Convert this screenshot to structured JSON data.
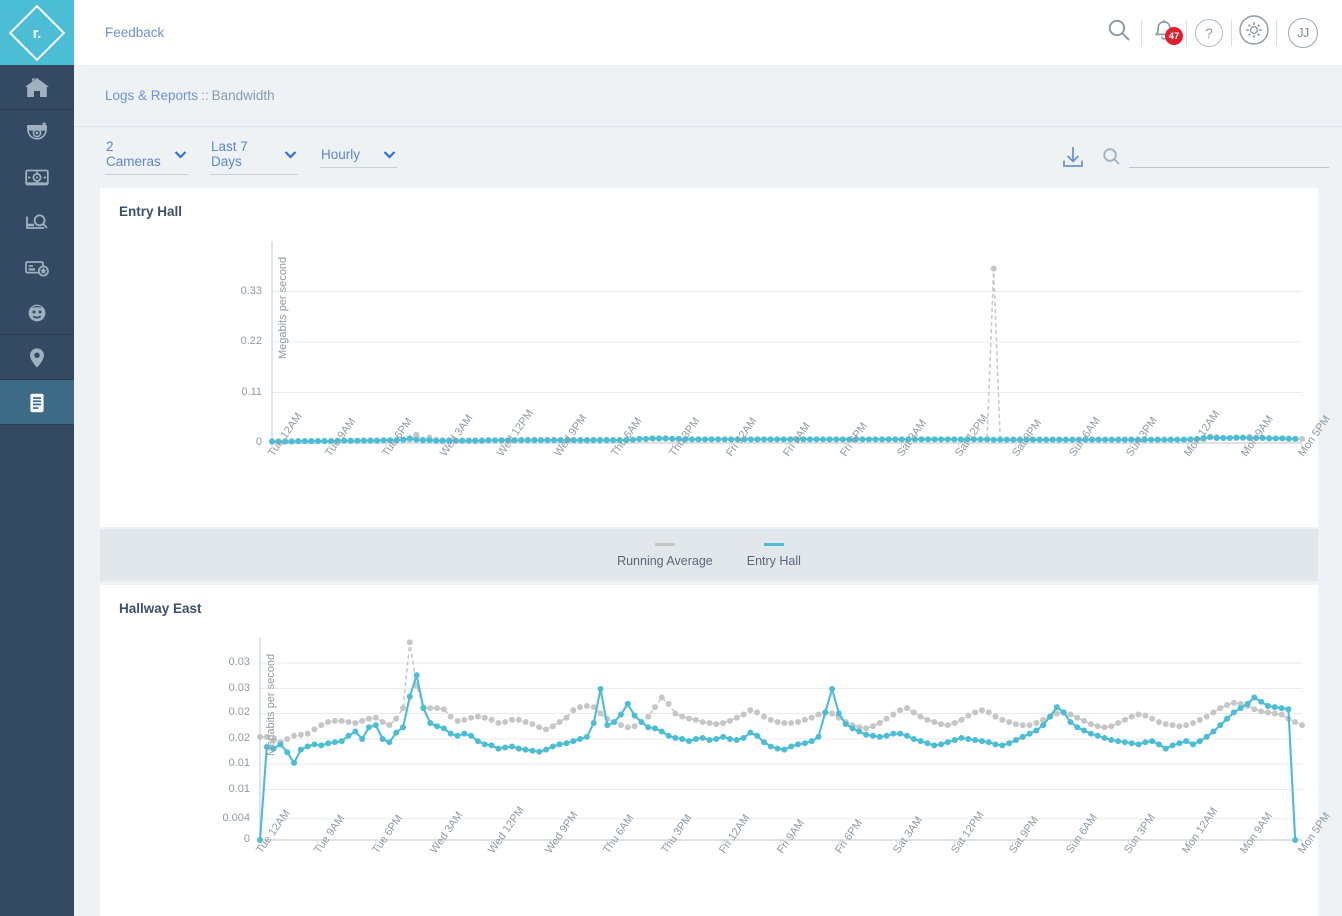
{
  "app": {
    "logo_text": "r.",
    "brand_color": "#4bbdd4",
    "sidebar_bg": "#344a63",
    "sidebar_active_bg": "#3d6a85"
  },
  "sidebar": {
    "items": [
      {
        "name": "sidebar-item-dashboard",
        "icon": "home-icon",
        "active": false,
        "divider": true
      },
      {
        "name": "sidebar-item-cameras",
        "icon": "dome-camera-icon",
        "active": false,
        "divider": false
      },
      {
        "name": "sidebar-item-monitor",
        "icon": "monitor-target-icon",
        "active": false,
        "divider": false
      },
      {
        "name": "sidebar-item-investigate",
        "icon": "search-footage-icon",
        "active": false,
        "divider": false
      },
      {
        "name": "sidebar-item-license-plate",
        "icon": "card-star-icon",
        "active": false,
        "divider": false
      },
      {
        "name": "sidebar-item-people",
        "icon": "face-icon",
        "active": false,
        "divider": true
      },
      {
        "name": "sidebar-item-locations",
        "icon": "map-pin-icon",
        "active": false,
        "divider": true
      },
      {
        "name": "sidebar-item-logs-reports",
        "icon": "document-lines-icon",
        "active": true,
        "divider": true
      }
    ]
  },
  "topbar": {
    "feedback_label": "Feedback",
    "search_icon": "search-icon",
    "notifications_icon": "bell-icon",
    "notifications_count": "47",
    "notifications_badge_color": "#e0212b",
    "help_icon": "question-mark-icon",
    "help_label": "?",
    "settings_icon": "gear-icon",
    "avatar_initials": "JJ"
  },
  "breadcrumb": {
    "parent": "Logs & Reports",
    "separator": "::",
    "current": "Bandwidth"
  },
  "filters": {
    "cameras": {
      "value": "2 Cameras"
    },
    "range": {
      "value": "Last 7 Days"
    },
    "granularity": {
      "value": "Hourly"
    },
    "download_icon": "download-icon",
    "search_icon": "search-icon",
    "search_value": "",
    "search_placeholder": ""
  },
  "legend": {
    "items": [
      {
        "label": "Running Average",
        "color": "#c6c6c6"
      },
      {
        "label": "Entry Hall",
        "color": "#4bbdd4"
      }
    ]
  },
  "chart_data": [
    {
      "type": "line",
      "title": "Entry Hall",
      "xlabel": "",
      "ylabel": "Megabits per second",
      "grid": true,
      "legend_position": "bottom",
      "ylim": [
        0,
        0.44
      ],
      "yticks": [
        "0",
        "0.11",
        "0.22",
        "0.33"
      ],
      "ytick_values": [
        0,
        0.11,
        0.22,
        0.33
      ],
      "xticks": [
        "Tue 12AM",
        "Tue 9AM",
        "Tue 6PM",
        "Wed 3AM",
        "Wed 12PM",
        "Wed 9PM",
        "Thu 6AM",
        "Thu 3PM",
        "Fri 12AM",
        "Fri 9AM",
        "Fri 6PM",
        "Sat 3AM",
        "Sat 12PM",
        "Sat 9PM",
        "Sun 6AM",
        "Sun 3PM",
        "Mon 12AM",
        "Mon 9AM",
        "Mon 5PM"
      ],
      "series": [
        {
          "name": "Running Average",
          "color": "#c6c6c6",
          "style": "dashed",
          "values": [
            0.004,
            0.004,
            0.004,
            0.004,
            0.004,
            0.004,
            0.004,
            0.005,
            0.005,
            0.005,
            0.005,
            0.005,
            0.005,
            0.005,
            0.006,
            0.006,
            0.006,
            0.006,
            0.006,
            0.006,
            0.007,
            0.007,
            0.018,
            0.007,
            0.012,
            0.007,
            0.006,
            0.006,
            0.006,
            0.006,
            0.006,
            0.006,
            0.006,
            0.006,
            0.006,
            0.006,
            0.006,
            0.006,
            0.007,
            0.007,
            0.007,
            0.007,
            0.007,
            0.007,
            0.007,
            0.007,
            0.007,
            0.007,
            0.007,
            0.007,
            0.007,
            0.007,
            0.007,
            0.007,
            0.007,
            0.007,
            0.008,
            0.008,
            0.009,
            0.009,
            0.009,
            0.009,
            0.009,
            0.009,
            0.008,
            0.008,
            0.008,
            0.008,
            0.008,
            0.008,
            0.008,
            0.008,
            0.008,
            0.008,
            0.008,
            0.008,
            0.008,
            0.008,
            0.008,
            0.008,
            0.008,
            0.008,
            0.008,
            0.008,
            0.008,
            0.008,
            0.008,
            0.008,
            0.008,
            0.008,
            0.008,
            0.008,
            0.008,
            0.008,
            0.008,
            0.008,
            0.008,
            0.008,
            0.008,
            0.008,
            0.008,
            0.008,
            0.008,
            0.008,
            0.008,
            0.008,
            0.008,
            0.008,
            0.008,
            0.008,
            0.38,
            0.008,
            0.008,
            0.008,
            0.008,
            0.008,
            0.008,
            0.008,
            0.008,
            0.008,
            0.008,
            0.008,
            0.008,
            0.008,
            0.008,
            0.008,
            0.008,
            0.008,
            0.008,
            0.008,
            0.008,
            0.008,
            0.008,
            0.008,
            0.008,
            0.008,
            0.008,
            0.008,
            0.008,
            0.008,
            0.008,
            0.008,
            0.008,
            0.012,
            0.013,
            0.011,
            0.011,
            0.011,
            0.011,
            0.014,
            0.012,
            0.011,
            0.011,
            0.01,
            0.01,
            0.01,
            0.009,
            0.009
          ]
        },
        {
          "name": "Entry Hall",
          "color": "#4bbdd4",
          "style": "solid",
          "values": [
            0.003,
            0.003,
            0.003,
            0.003,
            0.004,
            0.004,
            0.004,
            0.004,
            0.004,
            0.004,
            0.005,
            0.005,
            0.005,
            0.005,
            0.005,
            0.005,
            0.005,
            0.006,
            0.006,
            0.006,
            0.007,
            0.01,
            0.007,
            0.006,
            0.006,
            0.005,
            0.005,
            0.005,
            0.005,
            0.005,
            0.005,
            0.005,
            0.005,
            0.006,
            0.006,
            0.006,
            0.006,
            0.006,
            0.006,
            0.006,
            0.006,
            0.006,
            0.006,
            0.006,
            0.006,
            0.006,
            0.006,
            0.006,
            0.006,
            0.006,
            0.006,
            0.006,
            0.006,
            0.006,
            0.006,
            0.007,
            0.009,
            0.009,
            0.01,
            0.01,
            0.01,
            0.009,
            0.009,
            0.008,
            0.008,
            0.008,
            0.008,
            0.008,
            0.008,
            0.008,
            0.008,
            0.008,
            0.008,
            0.008,
            0.008,
            0.008,
            0.008,
            0.008,
            0.008,
            0.008,
            0.008,
            0.008,
            0.008,
            0.008,
            0.008,
            0.008,
            0.008,
            0.008,
            0.008,
            0.008,
            0.008,
            0.008,
            0.008,
            0.008,
            0.008,
            0.008,
            0.008,
            0.008,
            0.008,
            0.008,
            0.008,
            0.008,
            0.008,
            0.008,
            0.008,
            0.008,
            0.008,
            0.008,
            0.008,
            0.008,
            0.007,
            0.007,
            0.007,
            0.007,
            0.007,
            0.007,
            0.007,
            0.007,
            0.007,
            0.007,
            0.007,
            0.007,
            0.007,
            0.007,
            0.007,
            0.007,
            0.007,
            0.007,
            0.007,
            0.007,
            0.007,
            0.007,
            0.007,
            0.007,
            0.007,
            0.007,
            0.007,
            0.007,
            0.007,
            0.007,
            0.008,
            0.009,
            0.011,
            0.013,
            0.011,
            0.011,
            0.011,
            0.012,
            0.012,
            0.011,
            0.011,
            0.011,
            0.01,
            0.01,
            0.01,
            0.009,
            0.009
          ]
        }
      ]
    },
    {
      "type": "line",
      "title": "Hallway East",
      "xlabel": "",
      "ylabel": "Megabits per second",
      "grid": true,
      "ylim": [
        0,
        0.038
      ],
      "yticks": [
        "0",
        "0.004",
        "0.01",
        "0.01",
        "0.02",
        "0.02",
        "0.03",
        "0.03"
      ],
      "ytick_values": [
        0,
        0.004,
        0.0095,
        0.0143,
        0.019,
        0.0238,
        0.0285,
        0.0333
      ],
      "xticks": [
        "Tue 12AM",
        "Tue 9AM",
        "Tue 6PM",
        "Wed 3AM",
        "Wed 12PM",
        "Wed 9PM",
        "Thu 6AM",
        "Thu 3PM",
        "Fri 12AM",
        "Fri 9AM",
        "Fri 6PM",
        "Sat 3AM",
        "Sat 12PM",
        "Sat 9PM",
        "Sun 6AM",
        "Sun 3PM",
        "Mon 12AM",
        "Mon 9AM",
        "Mon 5PM"
      ],
      "series": [
        {
          "name": "Running Average",
          "color": "#c6c6c6",
          "style": "dashed",
          "values": [
            0.0194,
            0.0194,
            0.0188,
            0.0184,
            0.019,
            0.0196,
            0.0198,
            0.02,
            0.0208,
            0.0216,
            0.0222,
            0.0224,
            0.0224,
            0.0222,
            0.022,
            0.0224,
            0.0228,
            0.023,
            0.0222,
            0.0216,
            0.0228,
            0.0248,
            0.0372,
            0.029,
            0.025,
            0.0248,
            0.0248,
            0.0246,
            0.0232,
            0.0224,
            0.0226,
            0.023,
            0.0232,
            0.023,
            0.0226,
            0.022,
            0.0222,
            0.0226,
            0.0226,
            0.0222,
            0.0218,
            0.0212,
            0.0208,
            0.0214,
            0.0222,
            0.023,
            0.0244,
            0.025,
            0.0252,
            0.025,
            0.0238,
            0.0228,
            0.0222,
            0.0216,
            0.0212,
            0.0214,
            0.0222,
            0.0232,
            0.025,
            0.0268,
            0.0256,
            0.0238,
            0.0232,
            0.0228,
            0.0226,
            0.0222,
            0.022,
            0.0218,
            0.022,
            0.0224,
            0.023,
            0.0236,
            0.0244,
            0.024,
            0.0232,
            0.0226,
            0.0222,
            0.022,
            0.022,
            0.0222,
            0.0226,
            0.023,
            0.0236,
            0.024,
            0.0238,
            0.023,
            0.0222,
            0.0216,
            0.0212,
            0.021,
            0.0214,
            0.022,
            0.0228,
            0.0236,
            0.0244,
            0.0248,
            0.024,
            0.0232,
            0.0226,
            0.0222,
            0.0218,
            0.0216,
            0.022,
            0.0226,
            0.0234,
            0.024,
            0.0244,
            0.024,
            0.0232,
            0.0226,
            0.0222,
            0.0218,
            0.0216,
            0.0216,
            0.022,
            0.0226,
            0.0232,
            0.0238,
            0.024,
            0.0236,
            0.023,
            0.0224,
            0.0218,
            0.0214,
            0.0212,
            0.0214,
            0.022,
            0.0226,
            0.0232,
            0.0236,
            0.0234,
            0.0228,
            0.0222,
            0.0218,
            0.0216,
            0.0214,
            0.0216,
            0.022,
            0.0226,
            0.0232,
            0.024,
            0.0248,
            0.0254,
            0.0258,
            0.0256,
            0.0252,
            0.0246,
            0.0242,
            0.024,
            0.0238,
            0.0236,
            0.0228,
            0.0222,
            0.0216
          ]
        },
        {
          "name": "Hallway East",
          "color": "#4bbdd4",
          "style": "solid",
          "values": [
            0.0,
            0.0175,
            0.0172,
            0.018,
            0.0165,
            0.0145,
            0.017,
            0.0176,
            0.018,
            0.0178,
            0.0182,
            0.0184,
            0.0186,
            0.0196,
            0.0204,
            0.019,
            0.0212,
            0.0216,
            0.019,
            0.0184,
            0.0202,
            0.0212,
            0.027,
            0.031,
            0.0248,
            0.022,
            0.0214,
            0.021,
            0.02,
            0.0196,
            0.02,
            0.0196,
            0.0186,
            0.018,
            0.0178,
            0.0172,
            0.0174,
            0.0176,
            0.0172,
            0.017,
            0.0168,
            0.0166,
            0.017,
            0.0176,
            0.018,
            0.0182,
            0.0186,
            0.019,
            0.0194,
            0.022,
            0.0284,
            0.0216,
            0.0222,
            0.0236,
            0.0256,
            0.0234,
            0.0222,
            0.0212,
            0.021,
            0.0204,
            0.0196,
            0.0192,
            0.019,
            0.0186,
            0.019,
            0.0192,
            0.0188,
            0.019,
            0.0194,
            0.019,
            0.0188,
            0.0192,
            0.0202,
            0.0196,
            0.0184,
            0.0176,
            0.0172,
            0.017,
            0.0176,
            0.018,
            0.0182,
            0.0186,
            0.0194,
            0.024,
            0.0284,
            0.0238,
            0.0218,
            0.021,
            0.0204,
            0.0198,
            0.0196,
            0.0194,
            0.0196,
            0.02,
            0.02,
            0.0196,
            0.019,
            0.0186,
            0.0182,
            0.0178,
            0.018,
            0.0184,
            0.0188,
            0.0192,
            0.019,
            0.0188,
            0.0186,
            0.0184,
            0.018,
            0.0178,
            0.0182,
            0.0188,
            0.0194,
            0.02,
            0.0206,
            0.0216,
            0.0232,
            0.025,
            0.024,
            0.0222,
            0.0212,
            0.0206,
            0.02,
            0.0196,
            0.0192,
            0.0188,
            0.0186,
            0.0184,
            0.0182,
            0.018,
            0.0184,
            0.0186,
            0.018,
            0.0172,
            0.0178,
            0.0182,
            0.0186,
            0.018,
            0.0186,
            0.0194,
            0.0204,
            0.0216,
            0.0228,
            0.024,
            0.0248,
            0.0256,
            0.0268,
            0.026,
            0.0252,
            0.025,
            0.0248,
            0.0246,
            0.0
          ]
        }
      ]
    }
  ]
}
